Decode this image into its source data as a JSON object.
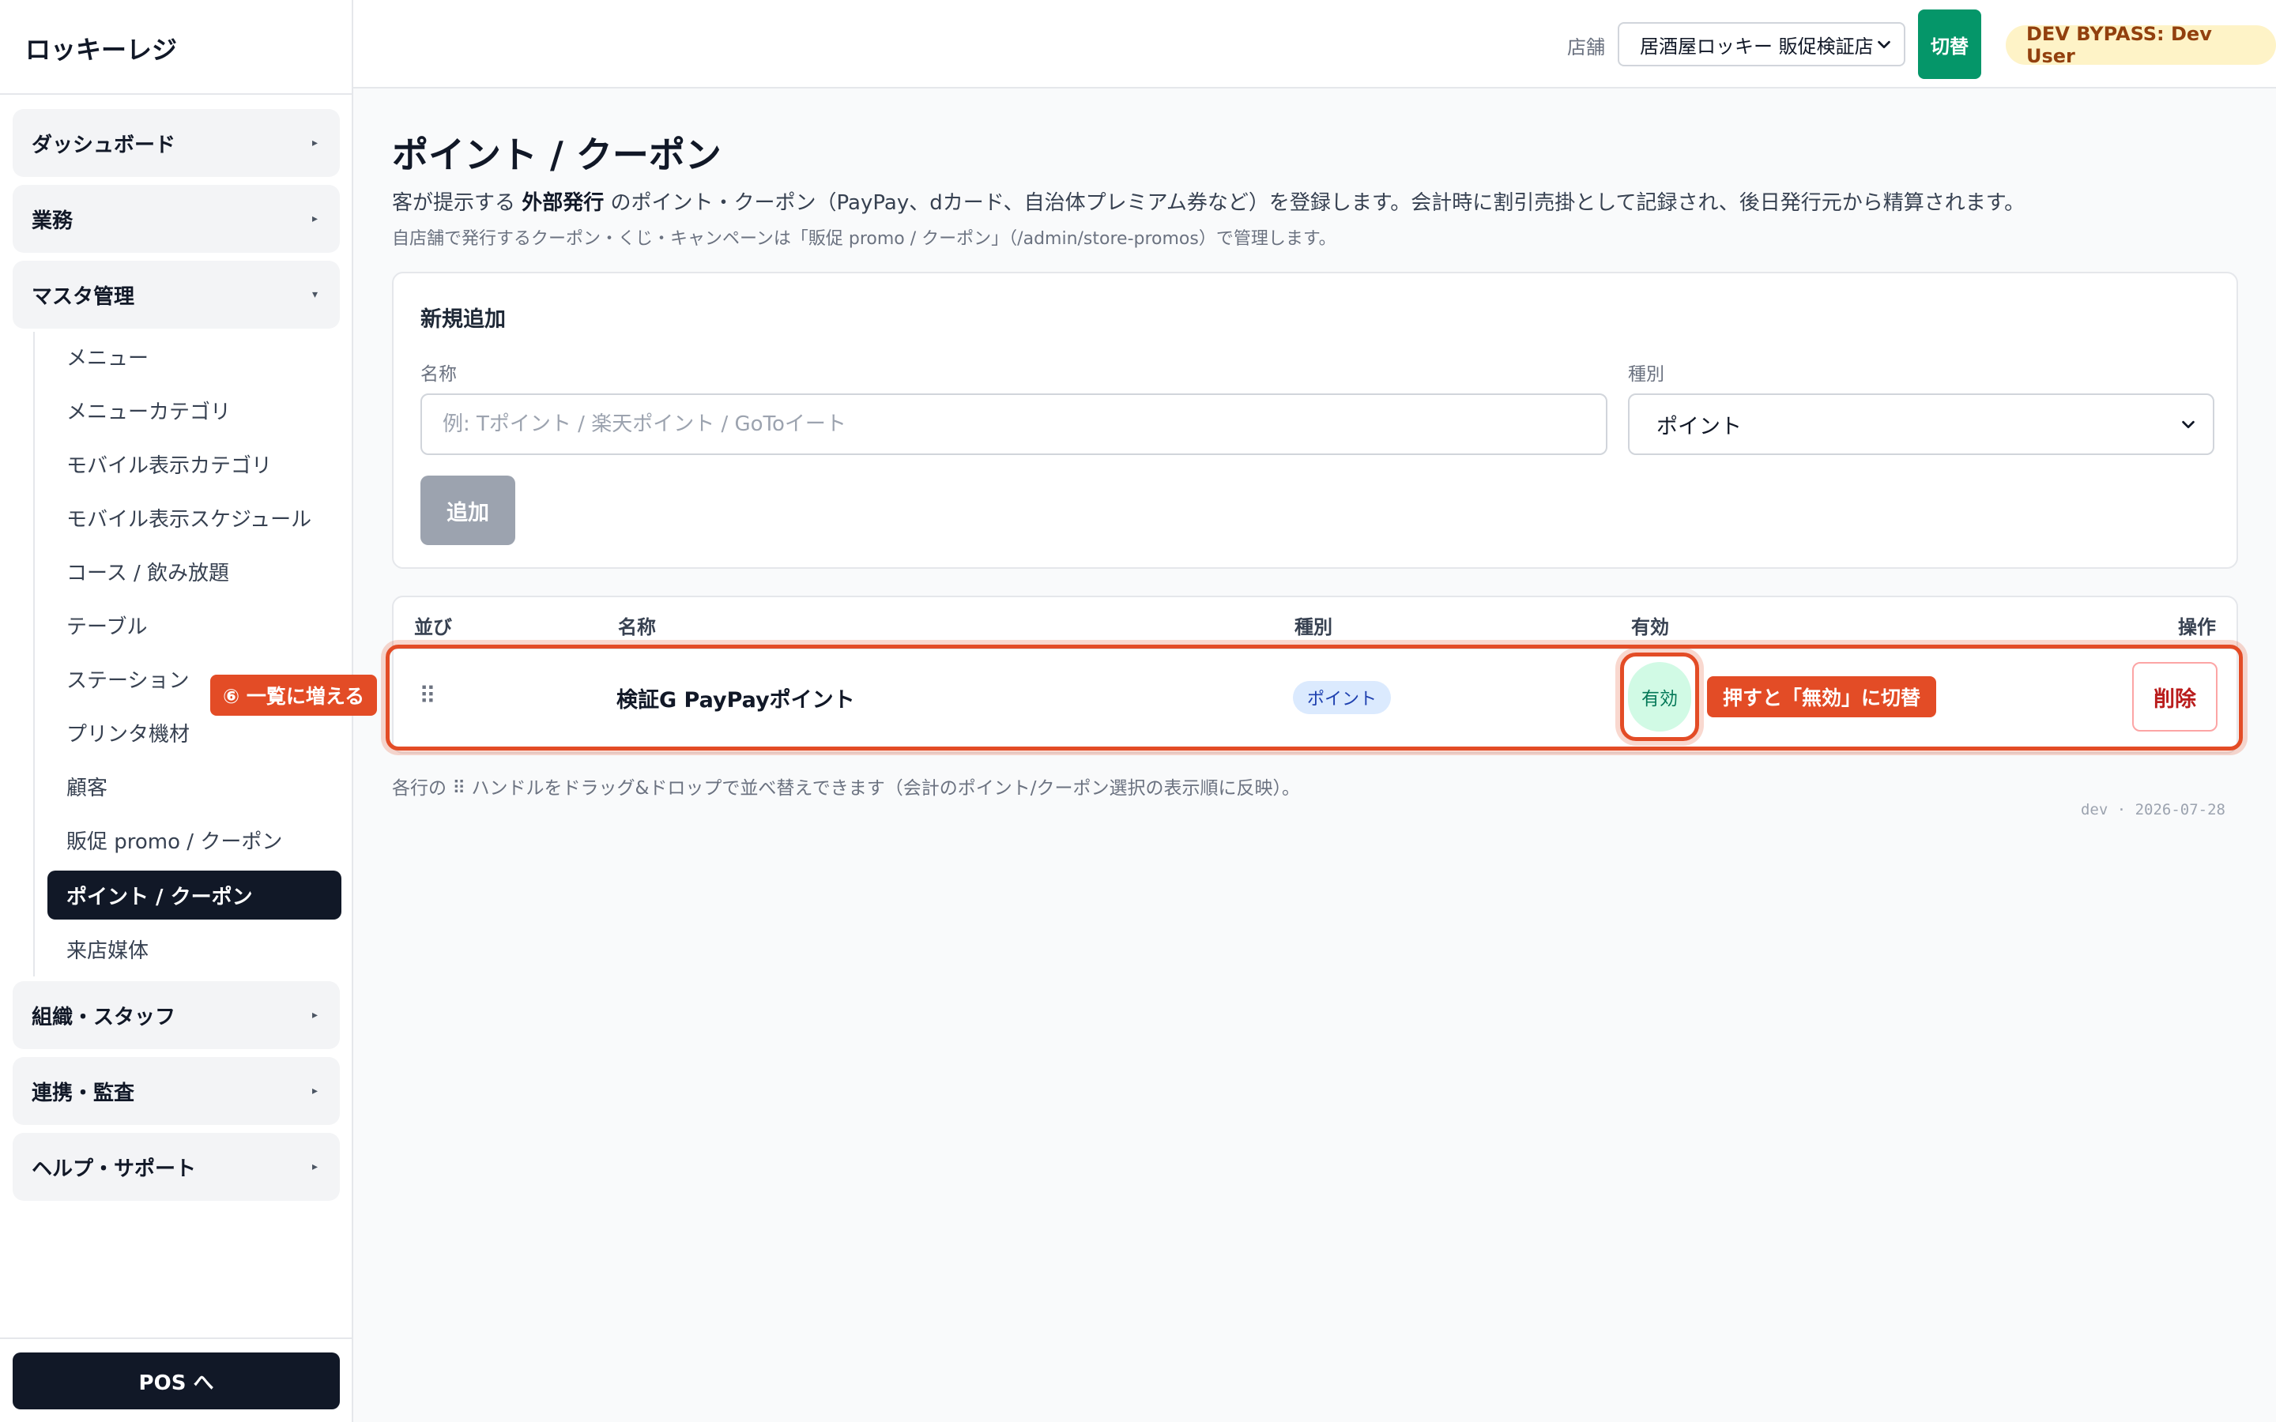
{
  "app": {
    "title": "ロッキーレジ"
  },
  "sidebar": {
    "groups": [
      {
        "label": "ダッシュボード",
        "caret": "▸"
      },
      {
        "label": "業務",
        "caret": "▸"
      },
      {
        "label": "マスタ管理",
        "caret": "▾"
      },
      {
        "label": "組織・スタッフ",
        "caret": "▸"
      },
      {
        "label": "連携・監査",
        "caret": "▸"
      },
      {
        "label": "ヘルプ・サポート",
        "caret": "▸"
      }
    ],
    "master_items": [
      {
        "label": "メニュー"
      },
      {
        "label": "メニューカテゴリ"
      },
      {
        "label": "モバイル表示カテゴリ"
      },
      {
        "label": "モバイル表示スケジュール"
      },
      {
        "label": "コース / 飲み放題"
      },
      {
        "label": "テーブル"
      },
      {
        "label": "ステーション"
      },
      {
        "label": "プリンタ機材"
      },
      {
        "label": "顧客"
      },
      {
        "label": "販促 promo / クーポン"
      },
      {
        "label": "ポイント / クーポン",
        "active": true
      },
      {
        "label": "来店媒体"
      }
    ],
    "pos_button": "POS へ"
  },
  "header": {
    "store_label": "店舗",
    "store_selected": "居酒屋ロッキー 販促検証店",
    "switch_button": "切替",
    "dev_badge": "DEV BYPASS: Dev User"
  },
  "page": {
    "title": "ポイント / クーポン",
    "desc_prefix": "客が提示する ",
    "desc_bold": "外部発行",
    "desc_suffix": " のポイント・クーポン（PayPay、dカード、自治体プレミアム券など）を登録します。会計時に割引売掛として記録され、後日発行元から精算されます。",
    "note": "自店舗で発行するクーポン・くじ・キャンペーンは「販促 promo / クーポン」（/admin/store-promos）で管理します。"
  },
  "form": {
    "title": "新規追加",
    "name_label": "名称",
    "name_placeholder": "例: Tポイント / 楽天ポイント / GoToイート",
    "name_value": "",
    "type_label": "種別",
    "type_selected": "ポイント",
    "add_button": "追加"
  },
  "table": {
    "columns": [
      "並び",
      "名称",
      "種別",
      "有効",
      "操作"
    ],
    "rows": [
      {
        "handle": "⠿",
        "name": "検証G PayPayポイント",
        "type": "ポイント",
        "active": "有効",
        "action": "削除"
      }
    ],
    "footer_note": "各行の ⠿ ハンドルをドラッグ&ドロップで並べ替えできます（会計のポイント/クーポン選択の表示順に反映）。"
  },
  "annotations": {
    "row_callout": "⑥ 一覧に増える",
    "toggle_callout": "押すと「無効」に切替"
  },
  "build_tag": "dev · 2026-07-28",
  "colors": {
    "primary_dark": "#111827",
    "accent_green": "#059669",
    "annotation_red": "#e34c26",
    "dev_badge_bg": "#fef3c7"
  }
}
